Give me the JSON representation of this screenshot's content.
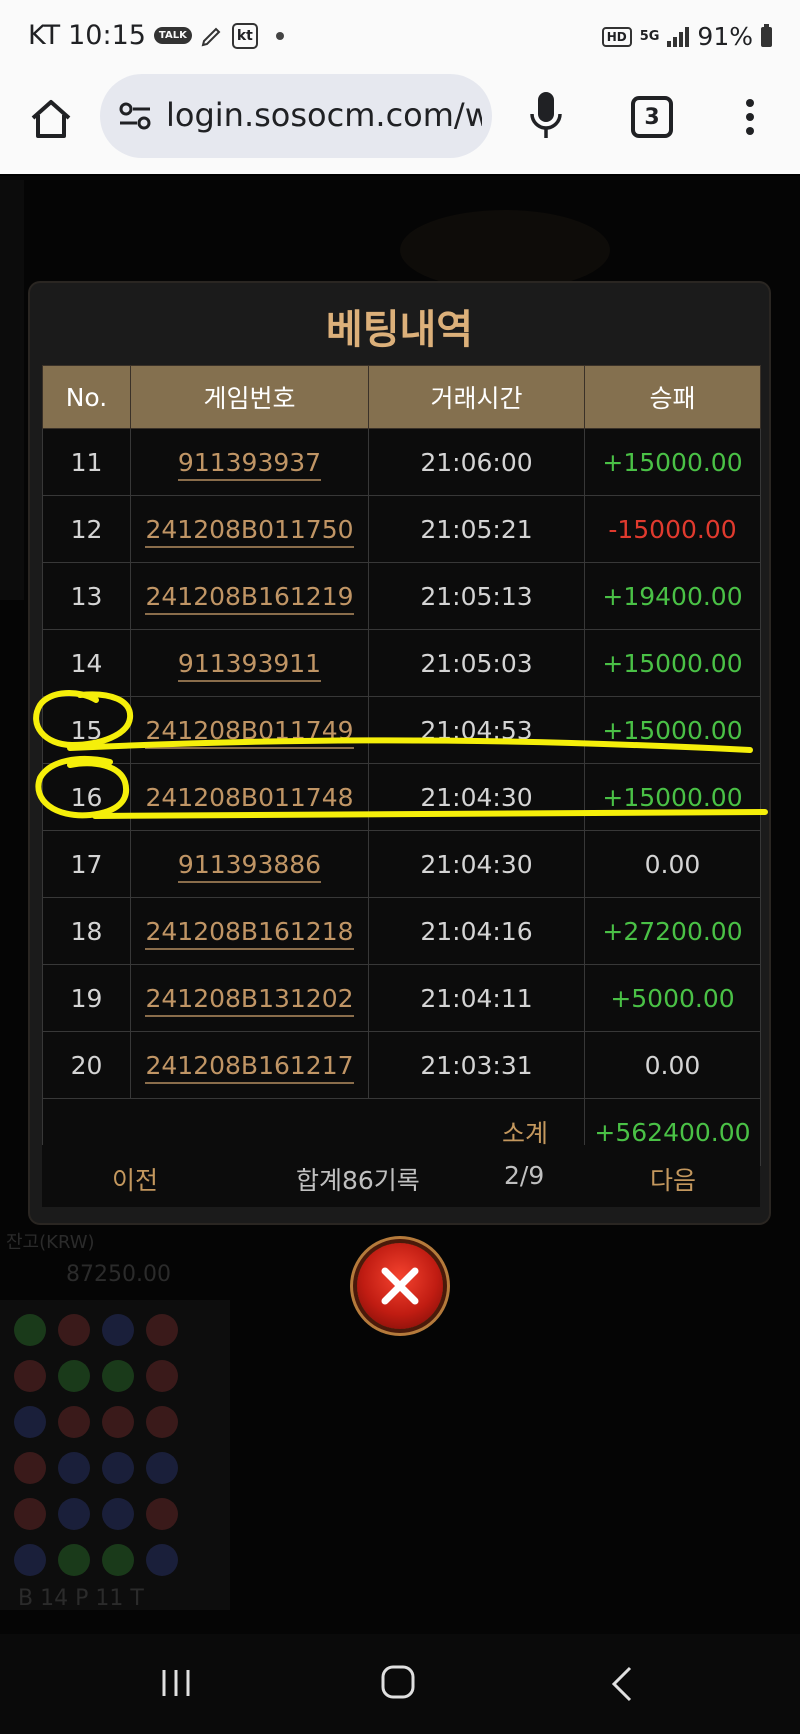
{
  "status_bar": {
    "carrier": "KT",
    "time": "10:15",
    "talk_icon_label": "TALK",
    "kt_icon_label": "kt",
    "hd_label": "HD",
    "network_label": "5G",
    "battery": "91%"
  },
  "browser": {
    "url": "login.sosocm.com/w",
    "tab_count": "3"
  },
  "modal": {
    "title": "베팅내역",
    "columns": [
      "No.",
      "게임번호",
      "거래시간",
      "승패"
    ],
    "rows": [
      {
        "no": "11",
        "game_id": "911393937",
        "time": "21:06:00",
        "result": "+15000.00",
        "status": "pos"
      },
      {
        "no": "12",
        "game_id": "241208B011750",
        "time": "21:05:21",
        "result": "-15000.00",
        "status": "neg"
      },
      {
        "no": "13",
        "game_id": "241208B161219",
        "time": "21:05:13",
        "result": "+19400.00",
        "status": "pos"
      },
      {
        "no": "14",
        "game_id": "911393911",
        "time": "21:05:03",
        "result": "+15000.00",
        "status": "pos"
      },
      {
        "no": "15",
        "game_id": "241208B011749",
        "time": "21:04:53",
        "result": "+15000.00",
        "status": "pos"
      },
      {
        "no": "16",
        "game_id": "241208B011748",
        "time": "21:04:30",
        "result": "+15000.00",
        "status": "pos"
      },
      {
        "no": "17",
        "game_id": "911393886",
        "time": "21:04:30",
        "result": "0.00",
        "status": "zero"
      },
      {
        "no": "18",
        "game_id": "241208B161218",
        "time": "21:04:16",
        "result": "+27200.00",
        "status": "pos"
      },
      {
        "no": "19",
        "game_id": "241208B131202",
        "time": "21:04:11",
        "result": "+5000.00",
        "status": "pos"
      },
      {
        "no": "20",
        "game_id": "241208B161217",
        "time": "21:03:31",
        "result": "0.00",
        "status": "zero"
      }
    ],
    "subtotal_label": "소계",
    "subtotal_value": "+562400.00",
    "pager": {
      "prev": "이전",
      "total": "합계86기록",
      "page": "2/9",
      "next": "다음"
    }
  },
  "background": {
    "balance_label": "잔고(KRW)",
    "balance_value": "87250.00",
    "roadmap_counts": "B 14 P 11 T"
  },
  "colors": {
    "accent_gold": "#dcb07a",
    "header_bg": "#84704f",
    "win_green": "#4ac146",
    "loss_red": "#e03a2e",
    "marker_yellow": "#f5ef0a"
  }
}
